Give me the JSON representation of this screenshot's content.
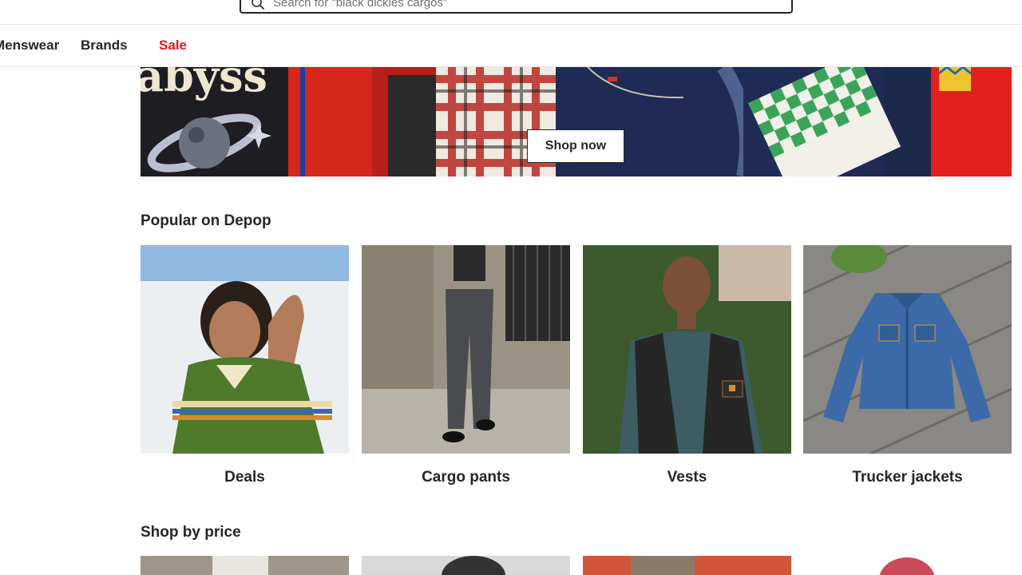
{
  "search": {
    "placeholder": "Search for \"black dickies cargos\""
  },
  "nav": {
    "items": [
      {
        "label": "Menswear"
      },
      {
        "label": "Brands"
      },
      {
        "label": "Sale"
      }
    ],
    "sale_color": "#e0171f"
  },
  "hero": {
    "cta_label": "Shop now",
    "graphic_text": "abyss"
  },
  "popular": {
    "title": "Popular on Depop",
    "cards": [
      {
        "label": "Deals"
      },
      {
        "label": "Cargo pants"
      },
      {
        "label": "Vests"
      },
      {
        "label": "Trucker jackets"
      }
    ]
  },
  "shop_by_price": {
    "title": "Shop by price"
  },
  "icons": {
    "search": "search-icon"
  }
}
